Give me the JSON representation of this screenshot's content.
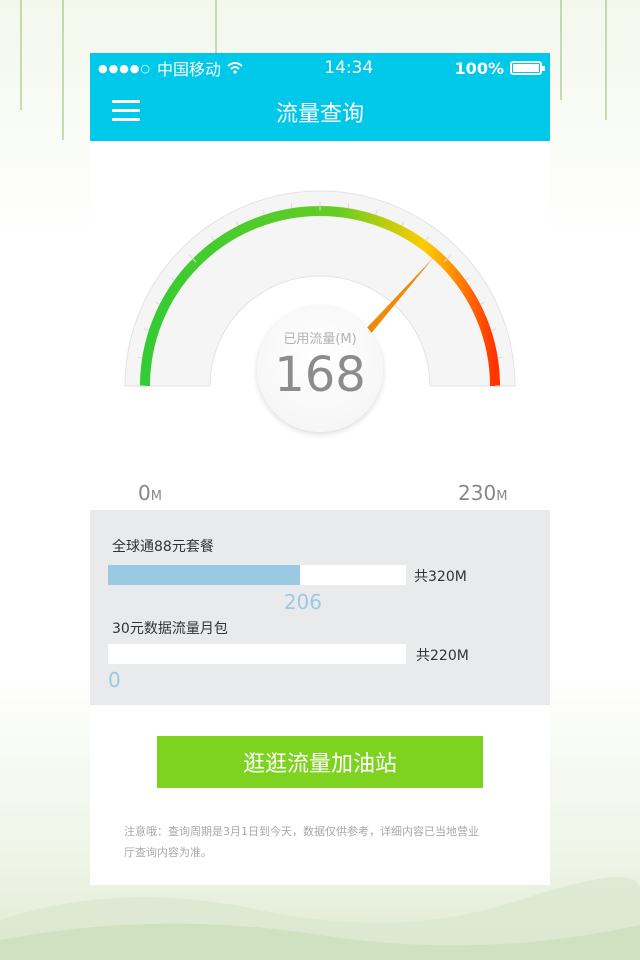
{
  "status_bar": {
    "carrier": "中国移动",
    "time": "14:34",
    "battery": "100%"
  },
  "nav": {
    "title": "流量查询"
  },
  "gauge": {
    "label": "已用流量(M)",
    "value": "168",
    "min_value": "0",
    "min_unit": "M",
    "max_value": "230",
    "max_unit": "M",
    "used": 168,
    "max": 230
  },
  "packages": [
    {
      "name": "全球通88元套餐",
      "used": "206",
      "total_label": "共320M",
      "used_value": 206,
      "total_value": 320
    },
    {
      "name": "30元数据流量月包",
      "used": "0",
      "total_label": "共220M",
      "used_value": 0,
      "total_value": 220
    }
  ],
  "cta": {
    "label": "逛逛流量加油站"
  },
  "note": "注意哦：查询周期是3月1日到今天，数据仅供参考，详细内容已当地营业厅查询内容为准。",
  "colors": {
    "header": "#00c8e8",
    "cta": "#7ed321",
    "bar_fill": "#9cc9e2",
    "panel": "#e9eaec"
  }
}
